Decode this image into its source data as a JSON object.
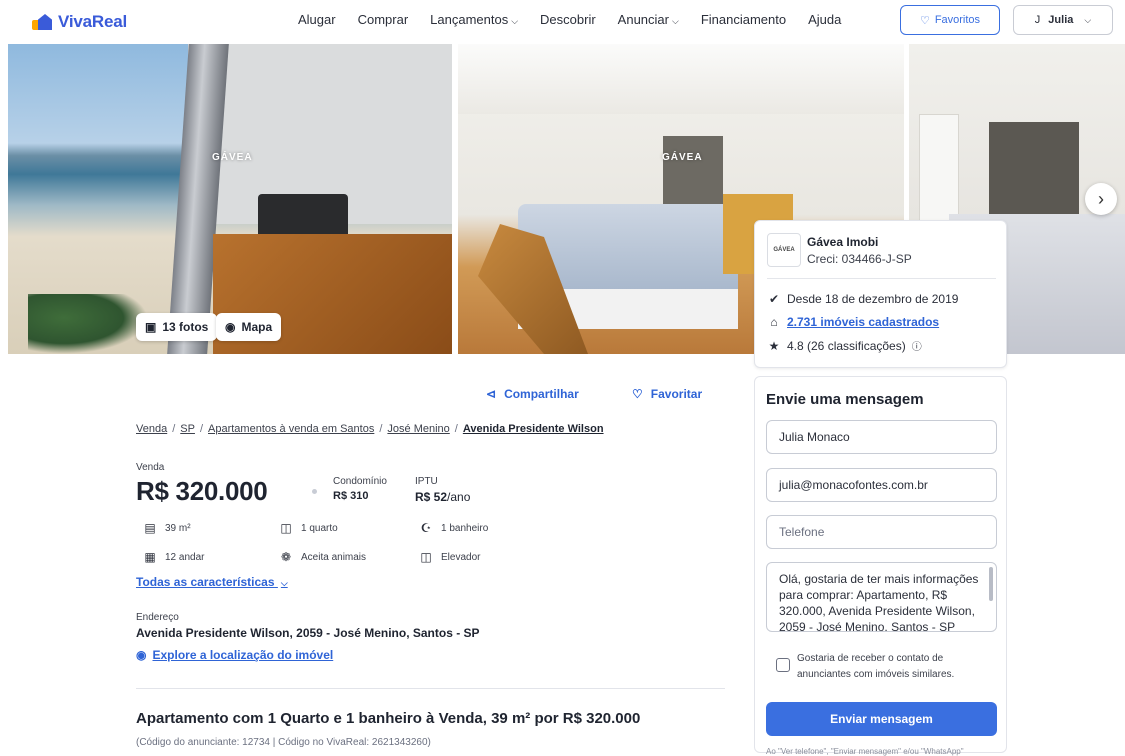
{
  "header": {
    "logo_text": "VivaReal",
    "nav": [
      "Alugar",
      "Comprar",
      "Lançamentos",
      "Descobrir",
      "Anunciar",
      "Financiamento",
      "Ajuda"
    ],
    "favorites_label": "Favoritos",
    "user_initial": "J",
    "user_name": "Julia"
  },
  "gallery": {
    "watermark": "GÁVEA",
    "photos_label": "13 fotos",
    "map_label": "Mapa"
  },
  "agency": {
    "logo_text": "GÁVEA",
    "name": "Gávea Imobi",
    "creci": "Creci: 034466-J-SP",
    "since": "Desde 18 de dezembro de 2019",
    "listings": "2.731 imóveis cadastrados",
    "rating": "4.8 (26 classificações)"
  },
  "message_form": {
    "title": "Envie uma mensagem",
    "name_value": "Julia Monaco",
    "email_value": "julia@monacofontes.com.br",
    "phone_placeholder": "Telefone",
    "message_value": "Olá, gostaria de ter mais informações para comprar: Apartamento, R$ 320.000, Avenida Presidente Wilson, 2059 - José Menino, Santos - SP",
    "opt_in_label": "Gostaria de receber o contato de anunciantes com imóveis similares.",
    "send_label": "Enviar mensagem",
    "footnote": "Ao \"Ver telefone\", \"Enviar mensagem\" e/ou \"WhatsApp\""
  },
  "actions": {
    "share_label": "Compartilhar",
    "favorite_label": "Favoritar"
  },
  "breadcrumb": {
    "items": [
      "Venda",
      "SP",
      "Apartamentos à venda em Santos",
      "José Menino"
    ],
    "current": "Avenida Presidente Wilson"
  },
  "listing": {
    "sale_label": "Venda",
    "price": "R$ 320.000",
    "condo_label": "Condomínio",
    "condo_value": "R$ 310",
    "iptu_label": "IPTU",
    "iptu_value": "R$ 52",
    "iptu_suffix": "/ano",
    "features": {
      "area": "39 m²",
      "bedrooms": "1 quarto",
      "bathrooms": "1 banheiro",
      "floor": "12 andar",
      "pets": "Aceita animais",
      "elevator": "Elevador"
    },
    "all_features_label": "Todas as características",
    "address_label": "Endereço",
    "address": "Avenida Presidente Wilson, 2059 - José Menino, Santos - SP",
    "explore_label": "Explore a localização do imóvel",
    "headline": "Apartamento com 1 Quarto e 1 banheiro à Venda, 39 m² por R$ 320.000",
    "codes": "(Código do anunciante: 12734 | Código no VivaReal: 2621343260)"
  }
}
